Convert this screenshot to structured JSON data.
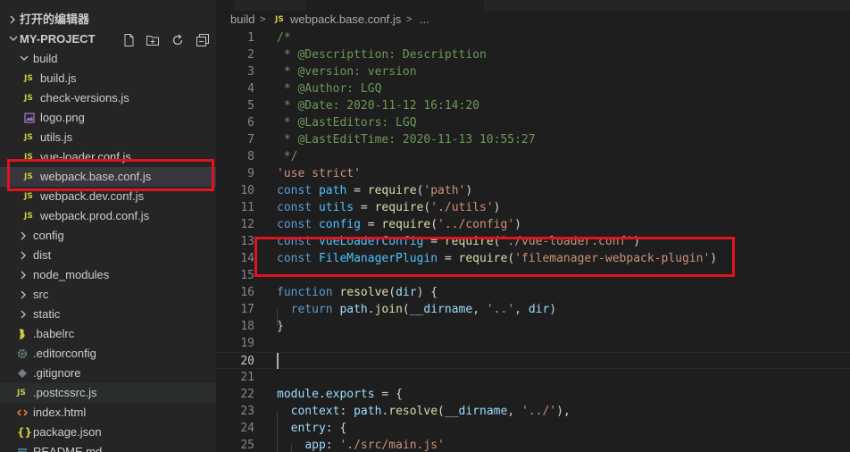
{
  "sidebar": {
    "open_editors_label": "打开的编辑器",
    "project_label": "MY-PROJECT",
    "tools": [
      "new-file-icon",
      "new-folder-icon",
      "refresh-icon",
      "collapse-all-icon"
    ],
    "items": [
      {
        "label": "build",
        "kind": "folder-open"
      },
      {
        "label": "build.js",
        "kind": "js"
      },
      {
        "label": "check-versions.js",
        "kind": "js"
      },
      {
        "label": "logo.png",
        "kind": "image"
      },
      {
        "label": "utils.js",
        "kind": "js"
      },
      {
        "label": "vue-loader.conf.js",
        "kind": "js"
      },
      {
        "label": "webpack.base.conf.js",
        "kind": "js"
      },
      {
        "label": "webpack.dev.conf.js",
        "kind": "js"
      },
      {
        "label": "webpack.prod.conf.js",
        "kind": "js"
      },
      {
        "label": "config",
        "kind": "folder"
      },
      {
        "label": "dist",
        "kind": "folder"
      },
      {
        "label": "node_modules",
        "kind": "folder"
      },
      {
        "label": "src",
        "kind": "folder"
      },
      {
        "label": "static",
        "kind": "folder"
      },
      {
        "label": ".babelrc",
        "kind": "babel"
      },
      {
        "label": ".editorconfig",
        "kind": "gear"
      },
      {
        "label": ".gitignore",
        "kind": "git"
      },
      {
        "label": ".postcssrc.js",
        "kind": "js"
      },
      {
        "label": "index.html",
        "kind": "html"
      },
      {
        "label": "package.json",
        "kind": "json"
      },
      {
        "label": "README.md",
        "kind": "md"
      }
    ],
    "js_badge": "JS"
  },
  "breadcrumb": {
    "folder": "build",
    "sep": ">",
    "file": "webpack.base.conf.js",
    "tail": "...",
    "js_badge": "JS"
  },
  "code": {
    "lines": [
      [
        [
          "/*",
          "t-comment"
        ]
      ],
      [
        [
          " * @Descripttion: Descripttion",
          "t-comment"
        ]
      ],
      [
        [
          " * @version: version",
          "t-comment"
        ]
      ],
      [
        [
          " * @Author: LGQ",
          "t-comment"
        ]
      ],
      [
        [
          " * @Date: 2020-11-12 16:14:20",
          "t-comment"
        ]
      ],
      [
        [
          " * @LastEditors: LGQ",
          "t-comment"
        ]
      ],
      [
        [
          " * @LastEditTime: 2020-11-13 10:55:27",
          "t-comment"
        ]
      ],
      [
        [
          " */",
          "t-comment"
        ]
      ],
      [
        [
          "'use strict'",
          "t-str"
        ]
      ],
      [
        [
          "const ",
          "t-kw"
        ],
        [
          "path",
          "t-const"
        ],
        [
          " = ",
          "t-punc"
        ],
        [
          "require",
          "t-fn"
        ],
        [
          "(",
          "t-punc"
        ],
        [
          "'path'",
          "t-str"
        ],
        [
          ")",
          "t-punc"
        ]
      ],
      [
        [
          "const ",
          "t-kw"
        ],
        [
          "utils",
          "t-const"
        ],
        [
          " = ",
          "t-punc"
        ],
        [
          "require",
          "t-fn"
        ],
        [
          "(",
          "t-punc"
        ],
        [
          "'./utils'",
          "t-str"
        ],
        [
          ")",
          "t-punc"
        ]
      ],
      [
        [
          "const ",
          "t-kw"
        ],
        [
          "config",
          "t-const"
        ],
        [
          " = ",
          "t-punc"
        ],
        [
          "require",
          "t-fn"
        ],
        [
          "(",
          "t-punc"
        ],
        [
          "'../config'",
          "t-str"
        ],
        [
          ")",
          "t-punc"
        ]
      ],
      [
        [
          "const ",
          "t-kw"
        ],
        [
          "vueLoaderConfig",
          "t-const"
        ],
        [
          " = ",
          "t-punc"
        ],
        [
          "require",
          "t-fn"
        ],
        [
          "(",
          "t-punc"
        ],
        [
          "'./vue-loader.conf'",
          "t-str"
        ],
        [
          ")",
          "t-punc"
        ]
      ],
      [
        [
          "const ",
          "t-kw"
        ],
        [
          "FileManagerPlugin",
          "t-const"
        ],
        [
          " = ",
          "t-punc"
        ],
        [
          "require",
          "t-fn"
        ],
        [
          "(",
          "t-punc"
        ],
        [
          "'filemanager-webpack-plugin'",
          "t-str"
        ],
        [
          ")",
          "t-punc"
        ]
      ],
      [],
      [
        [
          "function ",
          "t-kw"
        ],
        [
          "resolve",
          "t-fn"
        ],
        [
          "(",
          "t-punc"
        ],
        [
          "dir",
          "t-var"
        ],
        [
          ") {",
          "t-punc"
        ]
      ],
      [
        [
          "  ",
          "t-punc"
        ],
        [
          "return ",
          "t-kw"
        ],
        [
          "path",
          "t-var"
        ],
        [
          ".",
          "t-punc"
        ],
        [
          "join",
          "t-fn"
        ],
        [
          "(",
          "t-punc"
        ],
        [
          "__dirname",
          "t-var"
        ],
        [
          ", ",
          "t-punc"
        ],
        [
          "'..'",
          "t-str"
        ],
        [
          ", ",
          "t-punc"
        ],
        [
          "dir",
          "t-var"
        ],
        [
          ")",
          "t-punc"
        ]
      ],
      [
        [
          "}",
          "t-punc"
        ]
      ],
      [],
      [],
      [],
      [
        [
          "module",
          "t-var"
        ],
        [
          ".",
          "t-punc"
        ],
        [
          "exports",
          "t-var"
        ],
        [
          " = {",
          "t-punc"
        ]
      ],
      [
        [
          "  ",
          "t-punc"
        ],
        [
          "context",
          "t-var"
        ],
        [
          ": ",
          "t-punc"
        ],
        [
          "path",
          "t-var"
        ],
        [
          ".",
          "t-punc"
        ],
        [
          "resolve",
          "t-fn"
        ],
        [
          "(",
          "t-punc"
        ],
        [
          "__dirname",
          "t-var"
        ],
        [
          ", ",
          "t-punc"
        ],
        [
          "'../'",
          "t-str"
        ],
        [
          "),",
          "t-punc"
        ]
      ],
      [
        [
          "  ",
          "t-punc"
        ],
        [
          "entry",
          "t-var"
        ],
        [
          ": {",
          "t-punc"
        ]
      ],
      [
        [
          "    ",
          "t-punc"
        ],
        [
          "app",
          "t-var"
        ],
        [
          ": ",
          "t-punc"
        ],
        [
          "'./src/main.js'",
          "t-str"
        ]
      ]
    ]
  }
}
